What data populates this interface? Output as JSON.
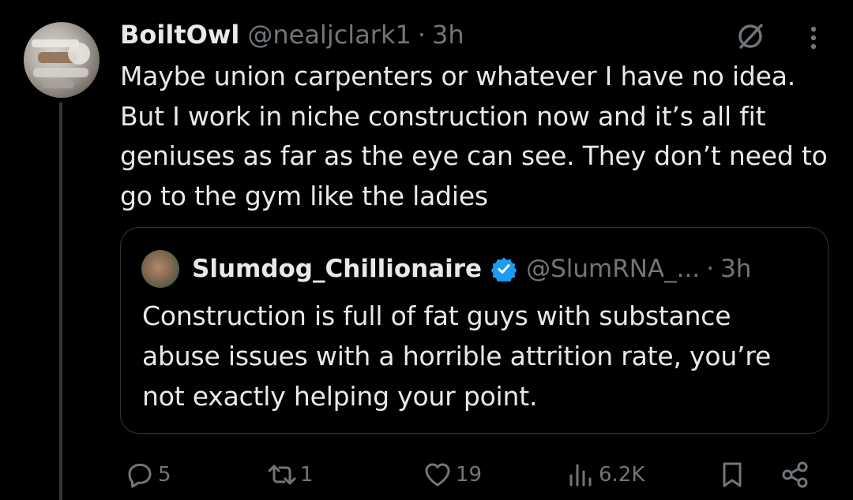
{
  "tweet": {
    "display_name": "BoiltOwl",
    "handle": "@nealjclark1",
    "separator": "·",
    "time": "3h",
    "text": "Maybe union carpenters or whatever I have no idea. But I work in niche construction now and it’s all fit geniuses as far as the eye can see. They don’t need to go to the gym like the ladies"
  },
  "quote": {
    "display_name": "Slumdog_Chillionaire",
    "handle": "@SlumRNA_...",
    "separator": "·",
    "time": "3h",
    "text": "Construction is full of fat guys with substance abuse issues with a horrible attrition rate, you’re not exactly helping your point."
  },
  "actions": {
    "replies": "5",
    "reposts": "1",
    "likes": "19",
    "views": "6.2K"
  },
  "icons": [
    "grok-icon",
    "more-icon",
    "verified-badge-icon",
    "reply-icon",
    "repost-icon",
    "like-icon",
    "views-icon",
    "bookmark-icon",
    "share-icon"
  ],
  "colors": {
    "background": "#000000",
    "text": "#e7e9ea",
    "secondary": "#71767b",
    "verified": "#1d9bf0",
    "border": "#2f3336"
  }
}
